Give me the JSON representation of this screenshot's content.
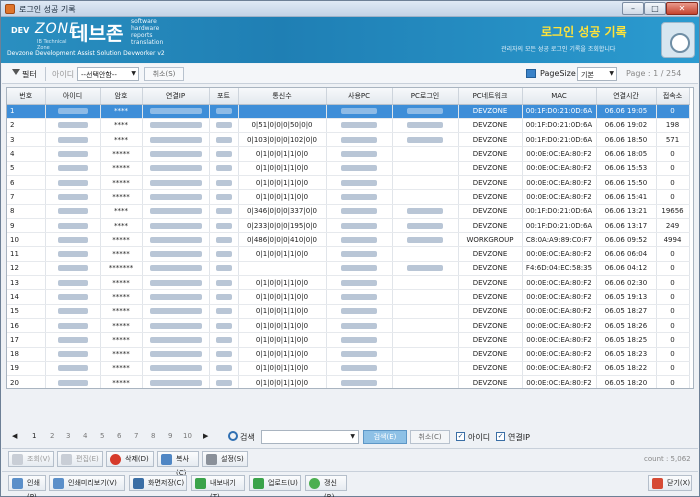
{
  "window": {
    "title": "로그인 성공 기록",
    "minimize": "–",
    "maximize": "□",
    "close": "✕"
  },
  "banner": {
    "logo_dev": "DEV",
    "logo_zone": "ZONE",
    "logo_sub": "IB Technical Zone",
    "brand_kr": "데브존",
    "brand_words": [
      "software",
      "hardware",
      "reports",
      "translation"
    ],
    "tagline": "Devzone Development Assist Solution Devworker v2",
    "page_heading": "로그인 성공 기록",
    "page_desc": "관리자의 모든 성공 로그인 기록을 조회합니다"
  },
  "filter": {
    "filter_label": "필터",
    "field_label": "아이디",
    "select_value": "--선택안함--",
    "cancel_label": "취소(S)",
    "page_size_label": "PageSize",
    "page_size_value": "기본",
    "page_info": "Page :   1  / 254"
  },
  "table": {
    "columns": [
      "번호",
      "아이디",
      "암호",
      "연결IP",
      "포트",
      "통신수",
      "사용PC",
      "PC로그인",
      "PC네트워크",
      "MAC",
      "연결시간",
      "접속소"
    ],
    "rows": [
      {
        "no": "1",
        "pw": "****",
        "comm": "",
        "net": "DEVZONE",
        "mac": "00:1F:D0:21:0D:6A",
        "time": "06.06 19:05",
        "cnt": "0",
        "selected": true
      },
      {
        "no": "2",
        "pw": "****",
        "comm": "0|51|0|0|0|50|0|0",
        "net": "DEVZONE",
        "mac": "00:1F:D0:21:0D:6A",
        "time": "06.06 19:02",
        "cnt": "198"
      },
      {
        "no": "3",
        "pw": "****",
        "comm": "0|103|0|0|0|102|0|0",
        "net": "DEVZONE",
        "mac": "00:1F:D0:21:0D:6A",
        "time": "06.06 18:50",
        "cnt": "571"
      },
      {
        "no": "4",
        "pw": "*****",
        "comm": "0|1|0|0|1|1|0|0",
        "net": "DEVZONE",
        "mac": "00:0E:0C:EA:80:F2",
        "time": "06.06 18:05",
        "cnt": "0"
      },
      {
        "no": "5",
        "pw": "*****",
        "comm": "0|1|0|0|1|1|0|0",
        "net": "DEVZONE",
        "mac": "00:0E:0C:EA:80:F2",
        "time": "06.06 15:53",
        "cnt": "0"
      },
      {
        "no": "6",
        "pw": "*****",
        "comm": "0|1|0|0|1|1|0|0",
        "net": "DEVZONE",
        "mac": "00:0E:0C:EA:80:F2",
        "time": "06.06 15:50",
        "cnt": "0"
      },
      {
        "no": "7",
        "pw": "*****",
        "comm": "0|1|0|0|1|1|0|0",
        "net": "DEVZONE",
        "mac": "00:0E:0C:EA:80:F2",
        "time": "06.06 15:41",
        "cnt": "0"
      },
      {
        "no": "8",
        "pw": "****",
        "comm": "0|346|0|0|0|337|0|0",
        "net": "DEVZONE",
        "mac": "00:1F:D0:21:0D:6A",
        "time": "06.06 13:21",
        "cnt": "19656"
      },
      {
        "no": "9",
        "pw": "****",
        "comm": "0|233|0|0|0|195|0|0",
        "net": "DEVZONE",
        "mac": "00:1F:D0:21:0D:6A",
        "time": "06.06 13:17",
        "cnt": "249"
      },
      {
        "no": "10",
        "pw": "*****",
        "comm": "0|486|0|0|0|410|0|0",
        "net": "WORKGROUP",
        "mac": "C8:0A:A9:89:C0:F7",
        "time": "06.06 09:52",
        "cnt": "4994"
      },
      {
        "no": "11",
        "pw": "*****",
        "comm": "0|1|0|0|1|1|0|0",
        "net": "DEVZONE",
        "mac": "00:0E:0C:EA:80:F2",
        "time": "06.06 06:04",
        "cnt": "0"
      },
      {
        "no": "12",
        "pw": "*******",
        "comm": "",
        "net": "DEVZONE",
        "mac": "F4:6D:04:EC:58:35",
        "time": "06.06 04:12",
        "cnt": "0"
      },
      {
        "no": "13",
        "pw": "*****",
        "comm": "0|1|0|0|1|1|0|0",
        "net": "DEVZONE",
        "mac": "00:0E:0C:EA:80:F2",
        "time": "06.06 02:30",
        "cnt": "0"
      },
      {
        "no": "14",
        "pw": "*****",
        "comm": "0|1|0|0|1|1|0|0",
        "net": "DEVZONE",
        "mac": "00:0E:0C:EA:80:F2",
        "time": "06.05 19:13",
        "cnt": "0"
      },
      {
        "no": "15",
        "pw": "*****",
        "comm": "0|1|0|0|1|1|0|0",
        "net": "DEVZONE",
        "mac": "00:0E:0C:EA:80:F2",
        "time": "06.05 18:27",
        "cnt": "0"
      },
      {
        "no": "16",
        "pw": "*****",
        "comm": "0|1|0|0|1|1|0|0",
        "net": "DEVZONE",
        "mac": "00:0E:0C:EA:80:F2",
        "time": "06.05 18:26",
        "cnt": "0"
      },
      {
        "no": "17",
        "pw": "*****",
        "comm": "0|1|0|0|1|1|0|0",
        "net": "DEVZONE",
        "mac": "00:0E:0C:EA:80:F2",
        "time": "06.05 18:25",
        "cnt": "0"
      },
      {
        "no": "18",
        "pw": "*****",
        "comm": "0|1|0|0|1|1|0|0",
        "net": "DEVZONE",
        "mac": "00:0E:0C:EA:80:F2",
        "time": "06.05 18:23",
        "cnt": "0"
      },
      {
        "no": "19",
        "pw": "*****",
        "comm": "0|1|0|0|1|1|0|0",
        "net": "DEVZONE",
        "mac": "00:0E:0C:EA:80:F2",
        "time": "06.05 18:22",
        "cnt": "0"
      },
      {
        "no": "20",
        "pw": "*****",
        "comm": "0|1|0|0|1|1|0|0",
        "net": "DEVZONE",
        "mac": "00:0E:0C:EA:80:F2",
        "time": "06.05 18:20",
        "cnt": "0"
      }
    ]
  },
  "pager": {
    "first": "◀",
    "pages": [
      "1",
      "2",
      "3",
      "4",
      "5",
      "6",
      "7",
      "8",
      "9",
      "10"
    ],
    "next": "▶",
    "search_label": "검색",
    "search_button": "검색(E)",
    "cancel_button": "취소(C)",
    "chk_id_label": "아이디",
    "chk_ip_label": "연결IP",
    "check_mark": "✓"
  },
  "toolbar1": {
    "view": "조회(V)",
    "edit": "편집(E)",
    "delete": "삭제(D)",
    "copy": "복사(C)",
    "settings": "설정(S)",
    "count": "count : 5,062"
  },
  "toolbar2": {
    "print": "인쇄(P)",
    "preview": "인쇄미리보기(V)",
    "screen_save": "화면저장(C)",
    "export": "내보내기(T)",
    "upload": "업로드(U)",
    "refresh": "갱신(R)",
    "close": "닫기(X)"
  },
  "colors": {
    "banner": "#2a8fc0",
    "selected_row": "#3e8ed8",
    "heading": "#ffe33a"
  }
}
